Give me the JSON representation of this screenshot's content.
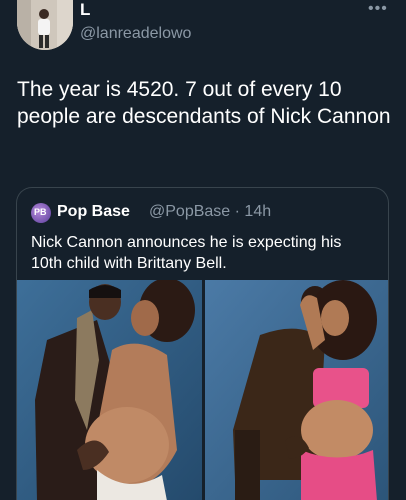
{
  "tweet": {
    "display_name": "L",
    "handle": "@lanreadelowo",
    "more_icon": "more-icon",
    "text": "The year is 4520. 7 out of every 10 people are descendants of Nick Cannon"
  },
  "quoted_tweet": {
    "display_name": "Pop Base",
    "handle": "@PopBase",
    "separator": "·",
    "time": "14h",
    "text": "Nick Cannon announces he is expecting his 10th child with Brittany Bell."
  },
  "colors": {
    "background": "#15202b",
    "text": "#ffffff",
    "secondary_text": "#8b98a5",
    "border": "#38444d"
  }
}
